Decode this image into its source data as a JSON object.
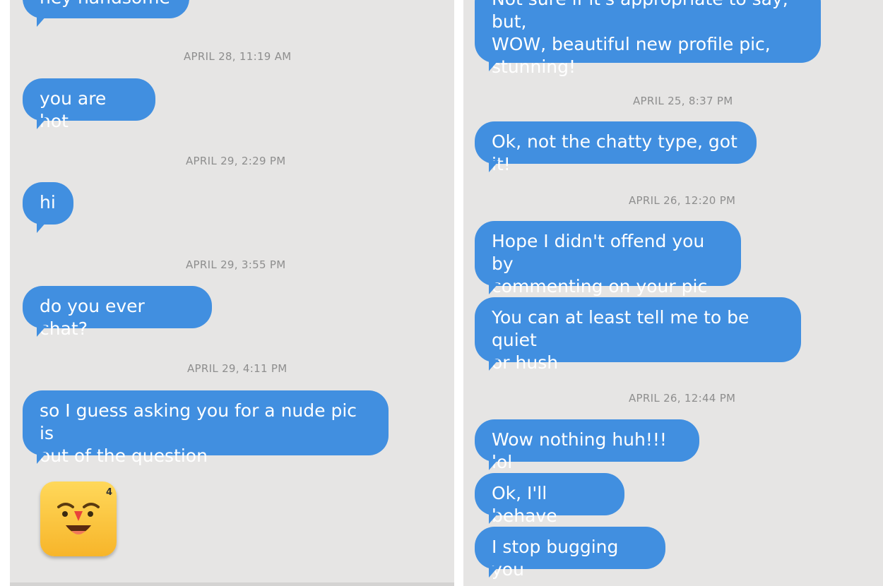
{
  "left_panel": {
    "top_bubble": "hey handsome",
    "messages": [
      {
        "timestamp": "APRIL 28, 11:19 AM",
        "text": "you are hot"
      },
      {
        "timestamp": "APRIL 29, 2:29 PM",
        "text": "hi"
      },
      {
        "timestamp": "APRIL 29, 3:55 PM",
        "text": "do you ever chat?"
      },
      {
        "timestamp": "APRIL 29, 4:11 PM",
        "text": "so I guess asking you for a nude pic is\nout of the question"
      }
    ],
    "emoji_badge": "4",
    "emoji_icon": "clown-face-icon"
  },
  "right_panel": {
    "top_bubble": "Not sure if it's appropriate to say, but,\nWOW, beautiful new profile pic,\nstunning!",
    "groups": [
      {
        "timestamp": "APRIL 25, 8:37 PM",
        "messages": [
          "Ok, not the chatty type, got it!"
        ]
      },
      {
        "timestamp": "APRIL 26, 12:20 PM",
        "messages": [
          "Hope I didn't offend you by\ncommenting on your pic",
          "You can at least tell me to be quiet\nor hush"
        ]
      },
      {
        "timestamp": "APRIL 26, 12:44 PM",
        "messages": [
          "Wow nothing huh!!! lol",
          "Ok, I'll behave",
          "I stop bugging you"
        ]
      }
    ]
  },
  "colors": {
    "bubble": "#418fe0",
    "panel_background": "#e6e5e4",
    "timestamp_text": "#8e8e8e"
  }
}
